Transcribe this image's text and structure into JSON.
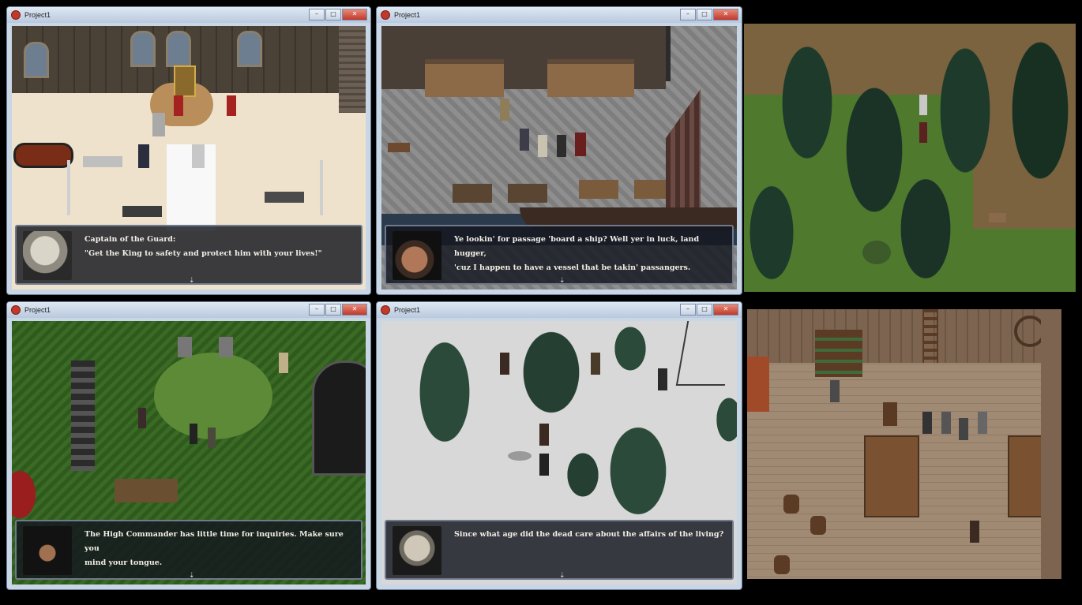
{
  "windows": [
    {
      "title": "Project1",
      "dialog": "Captain of the Guard:\n\"Get the King to safety and protect him with your lives!\""
    },
    {
      "title": "Project1",
      "dialog": "Ye lookin' for passage 'board a ship? Well yer in luck, land hugger,\n'cuz I happen to have a vessel that be takin' passangers."
    },
    {
      "title": "Project1",
      "dialog": "The High Commander has little time for inquiries. Make sure you\nmind your tongue."
    },
    {
      "title": "Project1",
      "dialog": "Since what age did the dead care about the affairs of the living?"
    }
  ],
  "window_buttons": {
    "minimize": "–",
    "maximize": "□",
    "close": "✕"
  },
  "cursor_glyph": "⇣"
}
